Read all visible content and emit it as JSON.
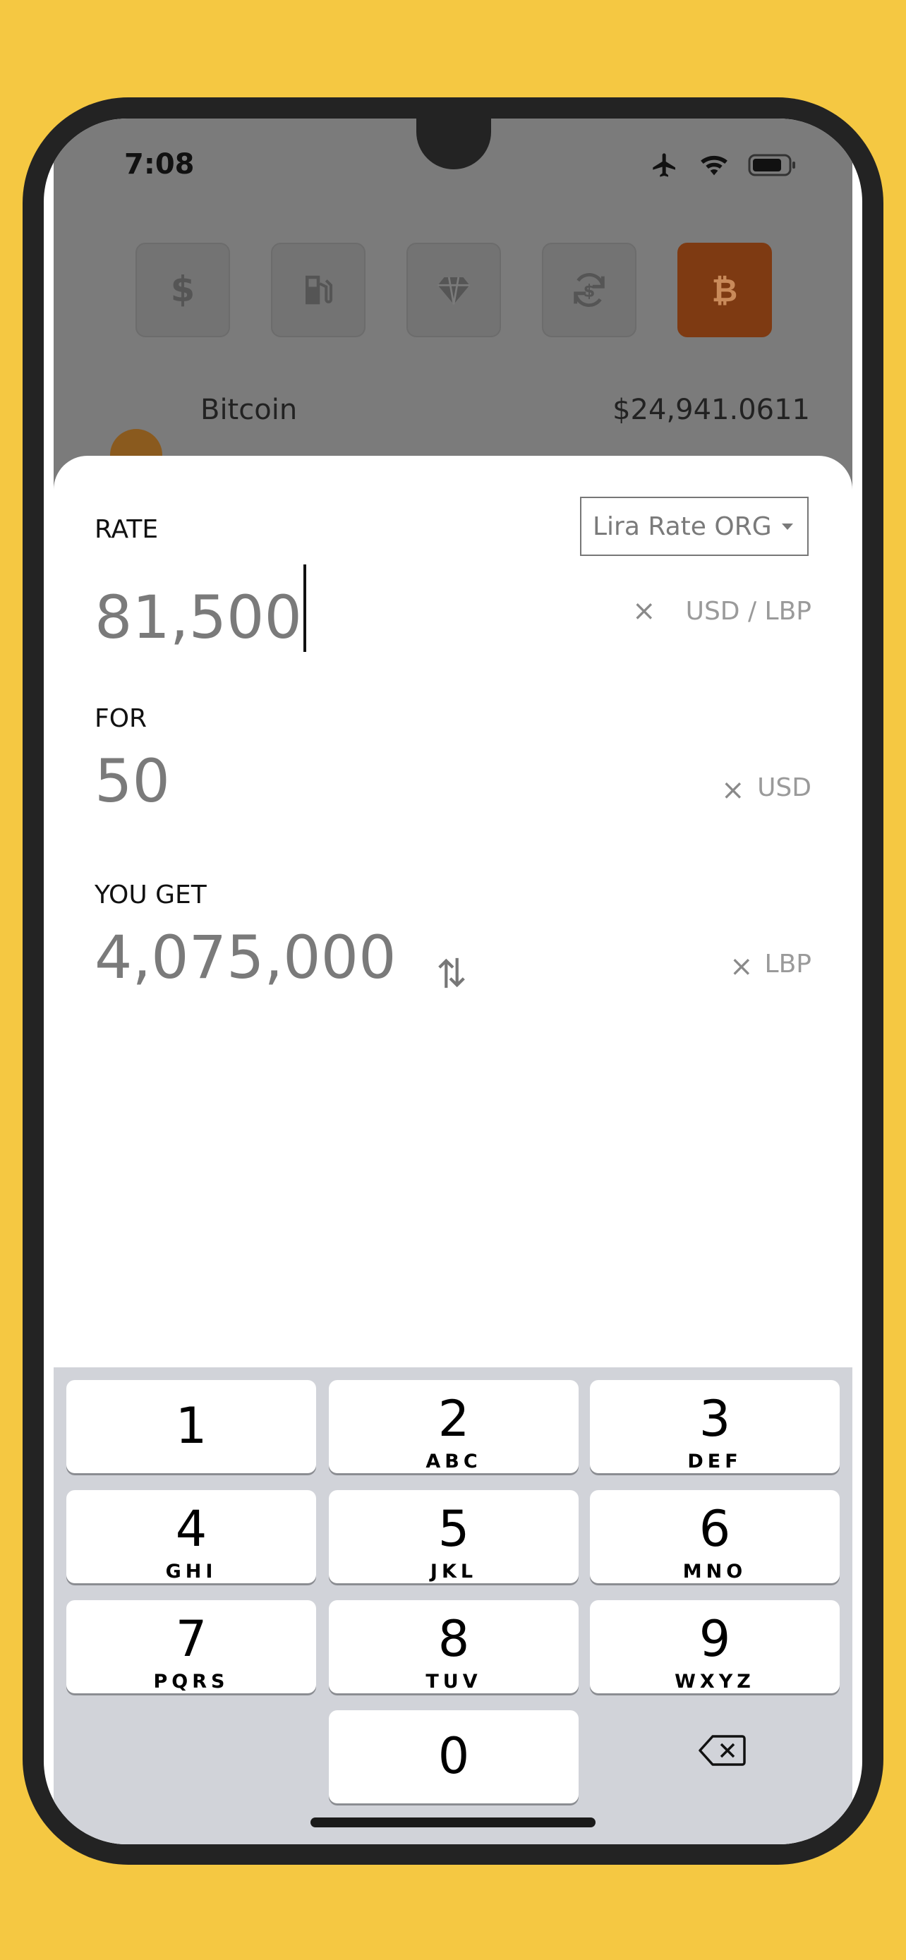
{
  "status_bar": {
    "time": "7:08"
  },
  "categories": [
    {
      "name": "dollar",
      "icon": "dollar-icon",
      "active": false
    },
    {
      "name": "fuel",
      "icon": "fuel-pump-icon",
      "active": false
    },
    {
      "name": "gold",
      "icon": "diamond-icon",
      "active": false
    },
    {
      "name": "exchange",
      "icon": "exchange-icon",
      "active": false
    },
    {
      "name": "bitcoin",
      "icon": "bitcoin-icon",
      "active": true
    }
  ],
  "list": {
    "bitcoin_name": "Bitcoin",
    "bitcoin_price": "$24,941.0611"
  },
  "converter": {
    "rate_label": "RATE",
    "rate_source": "Lira Rate ORG",
    "rate_value": "81,500",
    "rate_unit": "USD / LBP",
    "for_label": "FOR",
    "for_value": "50",
    "for_unit": "USD",
    "get_label": "YOU GET",
    "get_value": "4,075,000",
    "get_unit": "LBP",
    "clear_symbol": "×"
  },
  "keypad": {
    "k1": {
      "num": "1",
      "letters": ""
    },
    "k2": {
      "num": "2",
      "letters": "ABC"
    },
    "k3": {
      "num": "3",
      "letters": "DEF"
    },
    "k4": {
      "num": "4",
      "letters": "GHI"
    },
    "k5": {
      "num": "5",
      "letters": "JKL"
    },
    "k6": {
      "num": "6",
      "letters": "MNO"
    },
    "k7": {
      "num": "7",
      "letters": "PQRS"
    },
    "k8": {
      "num": "8",
      "letters": "TUV"
    },
    "k9": {
      "num": "9",
      "letters": "WXYZ"
    },
    "k0": {
      "num": "0",
      "letters": ""
    }
  },
  "colors": {
    "background": "#F5C842",
    "overlay": "#7b7b7b",
    "active_category": "#7e3a12",
    "keyboard": "#d1d3d9"
  }
}
